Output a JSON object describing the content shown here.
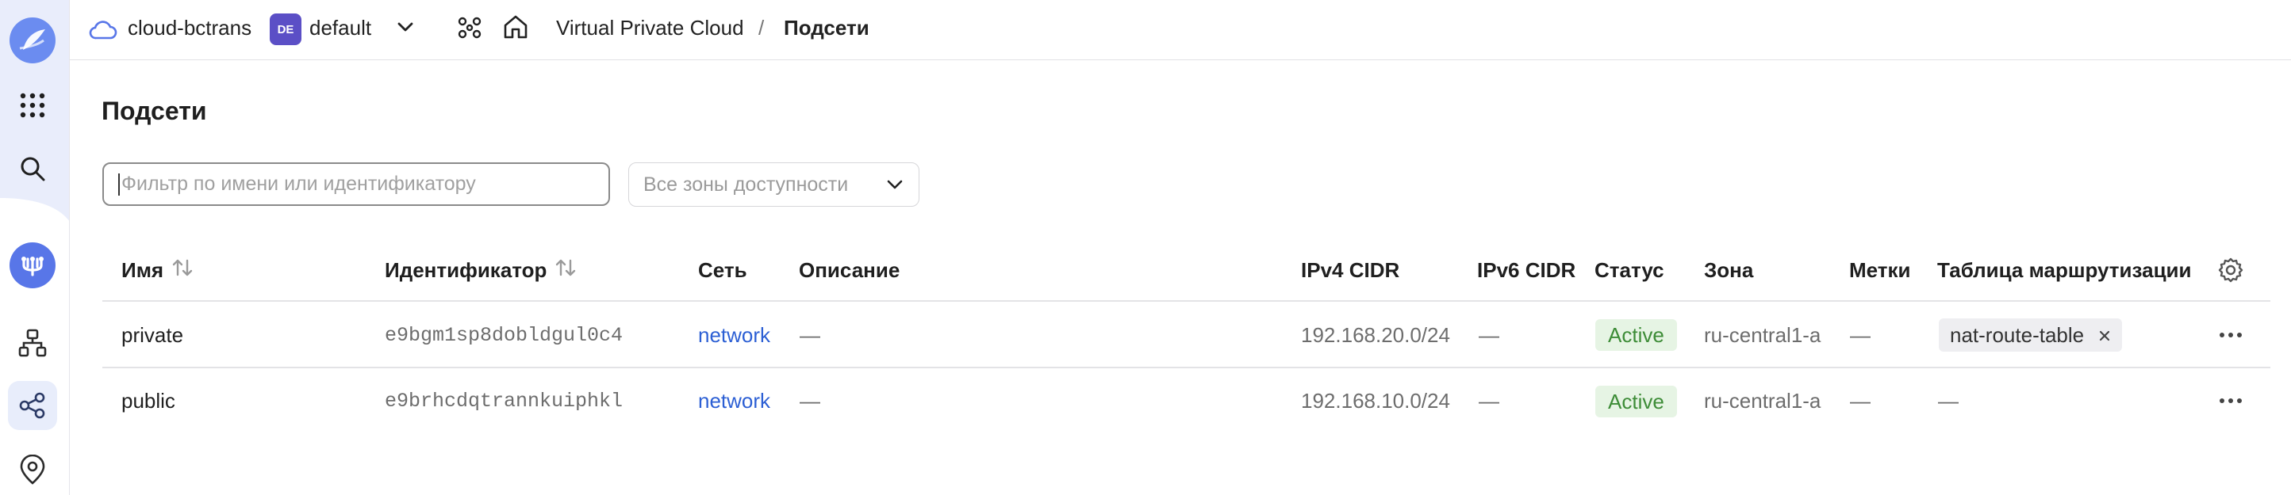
{
  "header": {
    "cloud_name": "cloud-bctrans",
    "folder_badge": "DE",
    "folder_name": "default",
    "breadcrumb_service": "Virtual Private Cloud",
    "breadcrumb_separator": "/",
    "breadcrumb_current": "Подсети"
  },
  "page": {
    "title": "Подсети"
  },
  "filters": {
    "search_placeholder": "Фильтр по имени или идентификатору",
    "zone_select_value": "Все зоны доступности"
  },
  "table": {
    "columns": [
      "Имя",
      "Идентификатор",
      "Сеть",
      "Описание",
      "IPv4 CIDR",
      "IPv6 CIDR",
      "Статус",
      "Зона",
      "Метки",
      "Таблица маршрутизации"
    ],
    "rows": [
      {
        "name": "private",
        "id": "e9bgm1sp8dobldgul0c4",
        "network": "network",
        "description": "—",
        "ipv4": "192.168.20.0/24",
        "ipv6": "—",
        "status": "Active",
        "zone": "ru-central1-a",
        "labels": "—",
        "route_table": "nat-route-table"
      },
      {
        "name": "public",
        "id": "e9brhcdqtrannkuiphkl",
        "network": "network",
        "description": "—",
        "ipv4": "192.168.10.0/24",
        "ipv6": "—",
        "status": "Active",
        "zone": "ru-central1-a",
        "labels": "—",
        "route_table": "—"
      }
    ]
  },
  "icons": {
    "logo": "cloud-logo-icon",
    "services": "grid-icon",
    "search": "search-icon",
    "vpc": "vpc-service-icon",
    "networks": "network-topology-icon",
    "subnets": "subnets-icon",
    "addresses": "location-pin-icon",
    "settings": "gear-icon",
    "sort": "sort-icon",
    "more": "more-dots-icon",
    "remove": "close-icon"
  },
  "colors": {
    "accent": "#5876e8",
    "link": "#2c5fd4",
    "status_active_bg": "#e6f4e4",
    "status_active_text": "#3d8c37",
    "folder_badge_bg": "#5b4fc6"
  }
}
